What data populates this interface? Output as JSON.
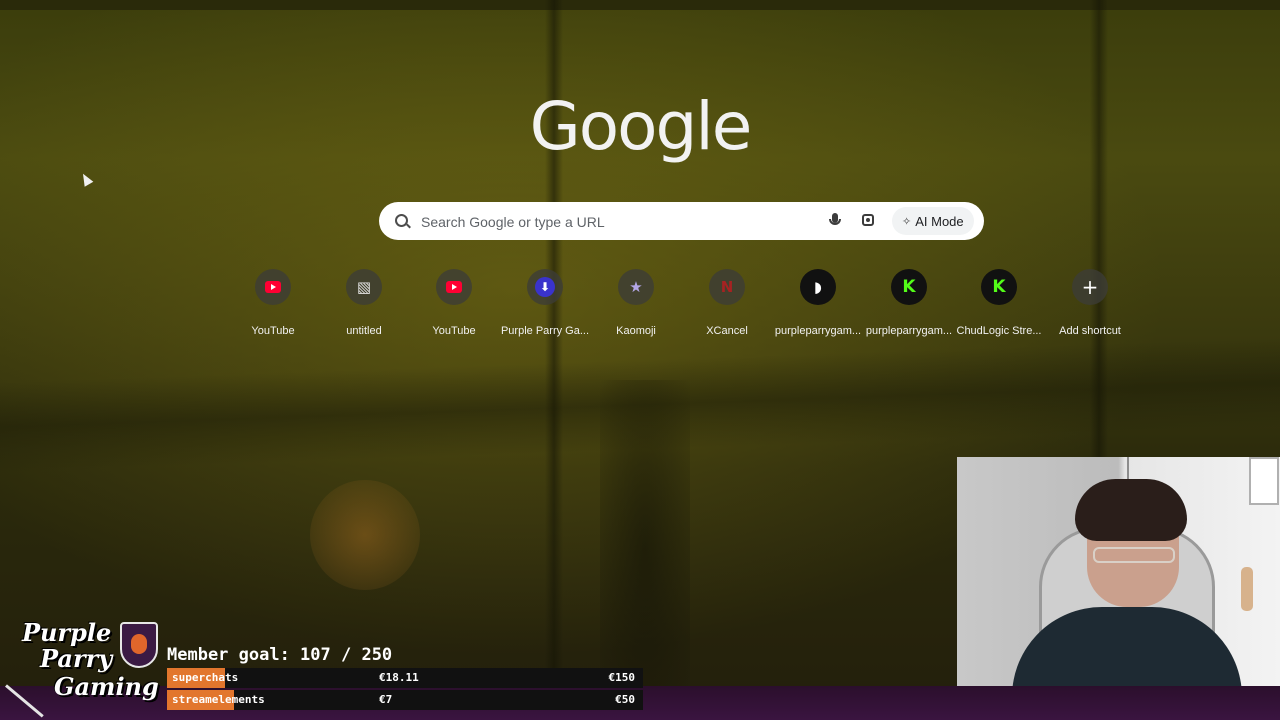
{
  "page": {
    "logo_text": "Google"
  },
  "search": {
    "placeholder": "Search Google or type a URL",
    "ai_mode_label": "AI Mode"
  },
  "shortcuts": [
    {
      "label": "YouTube",
      "icon": "youtube-icon",
      "color": "#ff0033"
    },
    {
      "label": "untitled",
      "icon": "document-icon",
      "color": "#e5e5e5"
    },
    {
      "label": "YouTube",
      "icon": "youtube-icon",
      "color": "#ff0033"
    },
    {
      "label": "Purple Parry Ga...",
      "icon": "purple-parry-icon",
      "color": "#3a33cc"
    },
    {
      "label": "Kaomoji",
      "icon": "star-icon",
      "color": "#b3a6e6"
    },
    {
      "label": "XCancel",
      "icon": "x-cancel-icon",
      "color": "#a62222"
    },
    {
      "label": "purpleparrygam...",
      "icon": "patreon-icon",
      "color": "#ffffff"
    },
    {
      "label": "purpleparrygam...",
      "icon": "kick-icon",
      "color": "#53fc18"
    },
    {
      "label": "ChudLogic Stre...",
      "icon": "kick-icon",
      "color": "#53fc18"
    },
    {
      "label": "Add shortcut",
      "icon": "plus-icon",
      "color": "#ffffff"
    }
  ],
  "overlay": {
    "brand_line1": "Purple",
    "brand_line2": "Parry",
    "brand_line3": "Gaming",
    "member_goal": "Member goal: 107 / 250",
    "goals": [
      {
        "name": "superchats",
        "amount": "€18.11",
        "target": "€150",
        "progress": 0.121
      },
      {
        "name": "streamelements",
        "amount": "€7",
        "target": "€50",
        "progress": 0.14
      }
    ],
    "accent_color": "#e2762d",
    "bar_color": "#3a1440"
  }
}
